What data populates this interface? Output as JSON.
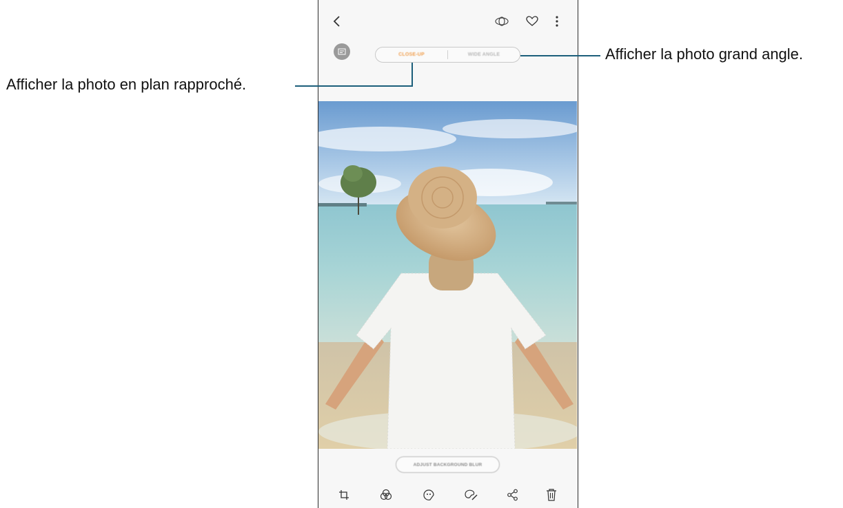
{
  "toolbar_top": {
    "back_icon": "chevron-left-icon",
    "bixby_icon": "bixby-vision-icon",
    "favorite_icon": "heart-icon",
    "more_icon": "more-vertical-icon"
  },
  "view_toggle": {
    "close_up_label": "CLOSE-UP",
    "wide_angle_label": "WIDE ANGLE",
    "active_color": "#f0a050",
    "inactive_color": "#b8b8b8"
  },
  "adjust_button": {
    "label": "ADJUST BACKGROUND BLUR"
  },
  "bottom_toolbar": {
    "icons": [
      "crop-icon",
      "filter-icon",
      "sticker-icon",
      "paint-icon",
      "share-icon",
      "trash-icon"
    ]
  },
  "callouts": {
    "left_text": "Afficher la photo en plan rapproché.",
    "right_text": "Afficher la photo grand angle."
  },
  "colors": {
    "callout_line": "#1b5e7a"
  }
}
